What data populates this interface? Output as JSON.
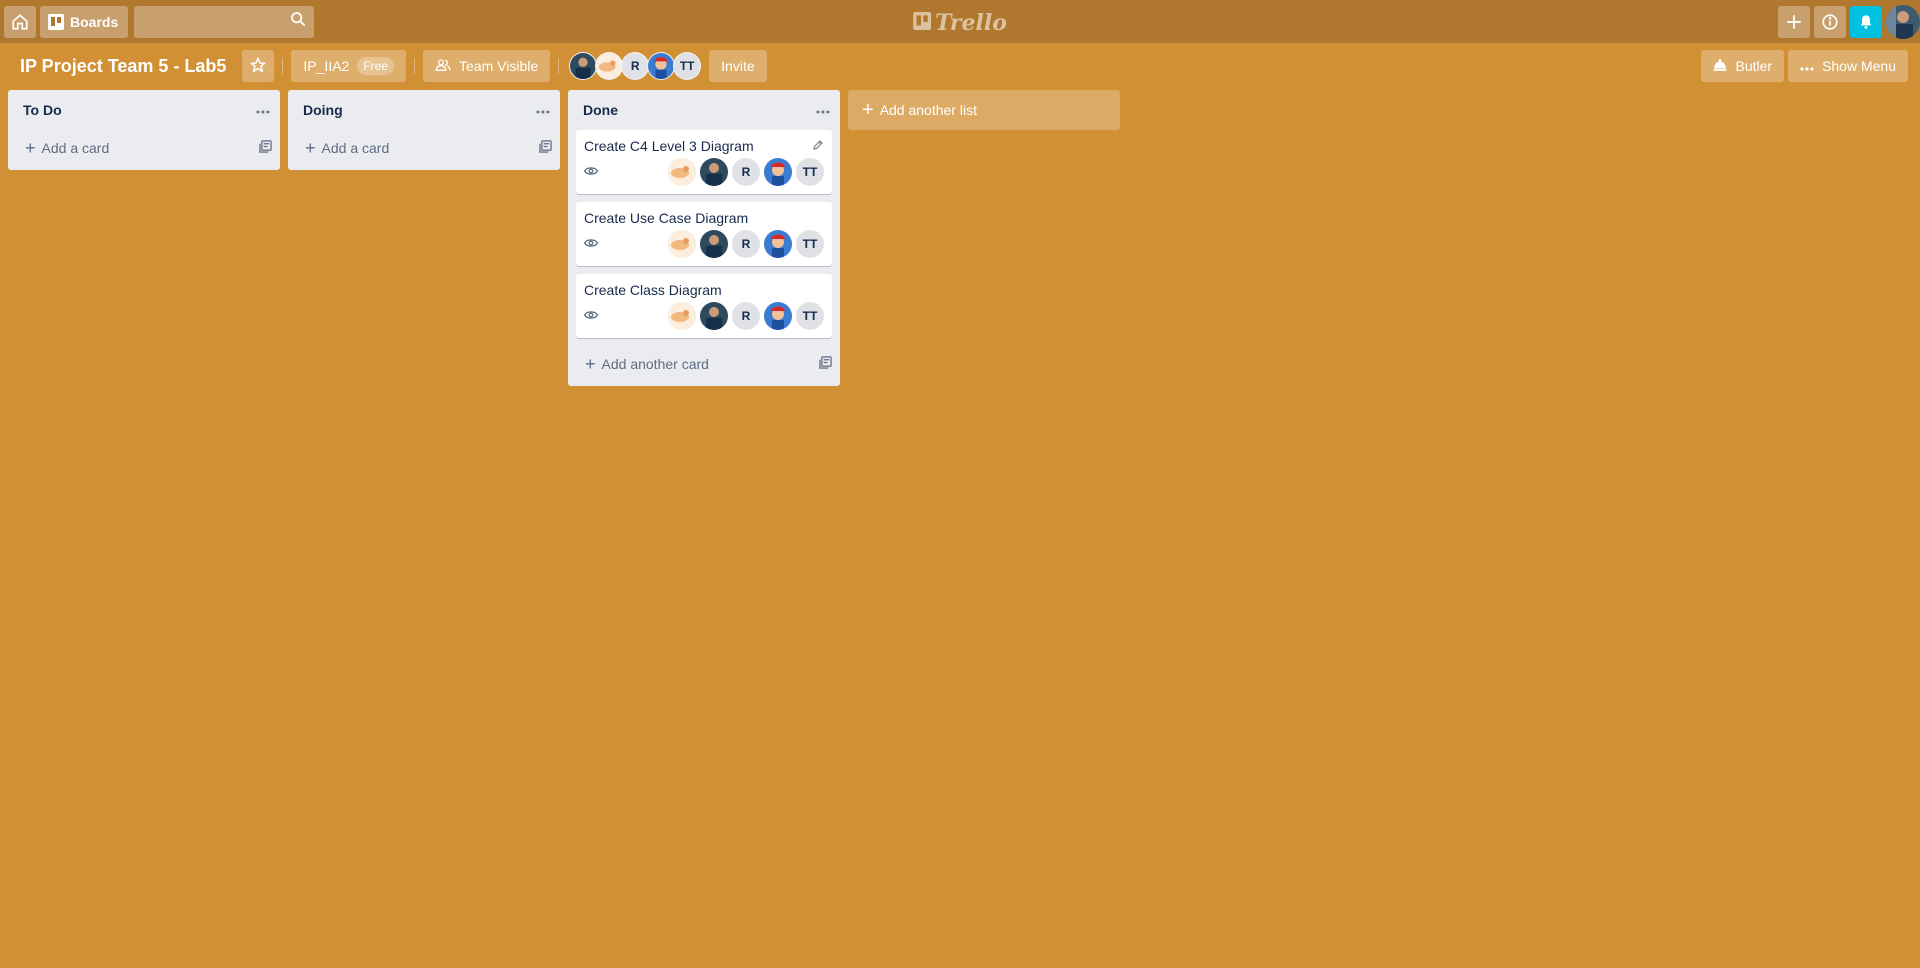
{
  "header": {
    "boards_label": "Boards",
    "search_placeholder": "",
    "logo_text": "Trello"
  },
  "board": {
    "title": "IP Project Team 5 - Lab5",
    "team_name": "IP_IIA2",
    "team_plan": "Free",
    "visibility": "Team Visible",
    "invite_label": "Invite",
    "butler_label": "Butler",
    "show_menu_label": "Show Menu",
    "members": [
      "photo",
      "photo",
      "R",
      "photo",
      "TT"
    ]
  },
  "lists": [
    {
      "title": "To Do",
      "add_card_label": "Add a card",
      "cards": []
    },
    {
      "title": "Doing",
      "add_card_label": "Add a card",
      "cards": []
    },
    {
      "title": "Done",
      "add_card_label": "Add another card",
      "cards": [
        {
          "title": "Create C4 Level 3 Diagram",
          "members": [
            "photo",
            "photo",
            "R",
            "photo",
            "TT"
          ]
        },
        {
          "title": "Create Use Case Diagram",
          "members": [
            "photo",
            "photo",
            "R",
            "photo",
            "TT"
          ]
        },
        {
          "title": "Create Class Diagram",
          "members": [
            "photo",
            "photo",
            "R",
            "photo",
            "TT"
          ]
        }
      ]
    }
  ],
  "add_list_label": "Add another list",
  "icons": {
    "home": "home-icon",
    "boards": "boards-icon",
    "search": "search-icon",
    "add": "plus-icon",
    "info": "info-icon",
    "notifications": "bell-icon",
    "star": "star-icon",
    "visibility": "team-icon",
    "butler": "butler-icon",
    "menu": "more-icon",
    "watch": "eye-icon",
    "edit": "pencil-icon",
    "template": "card-template-icon"
  },
  "colors": {
    "board_background": "#d29034",
    "header_background": "#b0782e",
    "notification_accent": "#00c2e0",
    "list_background": "#ebecf0"
  }
}
